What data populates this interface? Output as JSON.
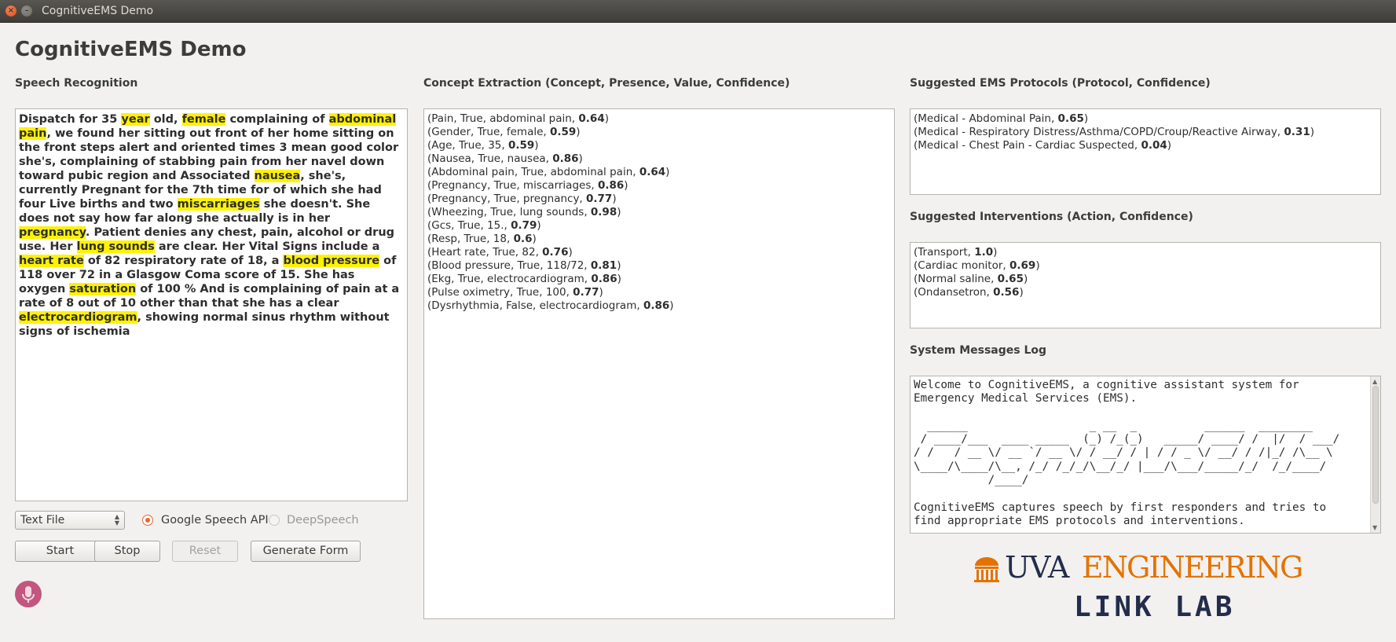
{
  "window": {
    "title": "CognitiveEMS Demo"
  },
  "app": {
    "title": "CognitiveEMS Demo"
  },
  "speech": {
    "label": "Speech Recognition",
    "segments": [
      {
        "t": "Dispatch for 35 ",
        "h": false
      },
      {
        "t": "year",
        "h": true
      },
      {
        "t": " old, ",
        "h": false
      },
      {
        "t": "female",
        "h": true
      },
      {
        "t": " complaining of ",
        "h": false
      },
      {
        "t": "abdominal pain",
        "h": true
      },
      {
        "t": ", we found her sitting out front of her home sitting on the front steps alert and oriented times 3 mean good color she's, complaining of stabbing pain from her navel down toward pubic region and Associated ",
        "h": false
      },
      {
        "t": "nausea",
        "h": true
      },
      {
        "t": ", she's, currently Pregnant for the 7th time for of which she had four Live births and two ",
        "h": false
      },
      {
        "t": "miscarriages",
        "h": true
      },
      {
        "t": " she doesn't. She does not say how far along she actually is in her ",
        "h": false
      },
      {
        "t": "pregnancy",
        "h": true
      },
      {
        "t": ". Patient denies any chest, pain, alcohol or drug use. Her ",
        "h": false
      },
      {
        "t": "lung sounds",
        "h": true
      },
      {
        "t": " are clear. Her Vital Signs include a ",
        "h": false
      },
      {
        "t": "heart rate",
        "h": true
      },
      {
        "t": " of 82 respiratory rate of 18, a ",
        "h": false
      },
      {
        "t": "blood pressure",
        "h": true
      },
      {
        "t": " of 118 over 72 in a Glasgow Coma score of 15. She has oxygen ",
        "h": false
      },
      {
        "t": "saturation",
        "h": true
      },
      {
        "t": " of 100 % And is complaining of pain at a rate of 8 out of 10 other than that she has a clear ",
        "h": false
      },
      {
        "t": "electrocardiogram",
        "h": true
      },
      {
        "t": ", showing normal sinus rhythm without signs of ischemia",
        "h": false
      }
    ]
  },
  "concepts": {
    "label": "Concept Extraction (Concept, Presence, Value, Confidence)",
    "items": [
      {
        "text": "(Pain, True, abdominal pain, ",
        "conf": "0.64"
      },
      {
        "text": "(Gender, True, female, ",
        "conf": "0.59"
      },
      {
        "text": "(Age, True, 35, ",
        "conf": "0.59"
      },
      {
        "text": "(Nausea, True, nausea, ",
        "conf": "0.86"
      },
      {
        "text": "(Abdominal pain, True, abdominal pain, ",
        "conf": "0.64"
      },
      {
        "text": "(Pregnancy, True, miscarriages, ",
        "conf": "0.86"
      },
      {
        "text": "(Pregnancy, True, pregnancy, ",
        "conf": "0.77"
      },
      {
        "text": "(Wheezing, True, lung sounds, ",
        "conf": "0.98"
      },
      {
        "text": "(Gcs, True, 15., ",
        "conf": "0.79"
      },
      {
        "text": "(Resp, True, 18, ",
        "conf": "0.6"
      },
      {
        "text": "(Heart rate, True, 82, ",
        "conf": "0.76"
      },
      {
        "text": "(Blood pressure, True, 118/72, ",
        "conf": "0.81"
      },
      {
        "text": "(Ekg, True, electrocardiogram, ",
        "conf": "0.86"
      },
      {
        "text": "(Pulse oximetry, True, 100, ",
        "conf": "0.77"
      },
      {
        "text": "(Dysrhythmia, False, electrocardiogram, ",
        "conf": "0.86"
      }
    ]
  },
  "protocols": {
    "label": "Suggested EMS Protocols (Protocol, Confidence)",
    "items": [
      {
        "text": "(Medical - Abdominal Pain, ",
        "conf": "0.65"
      },
      {
        "text": "(Medical - Respiratory Distress/Asthma/COPD/Croup/Reactive Airway, ",
        "conf": "0.31"
      },
      {
        "text": "(Medical - Chest Pain - Cardiac Suspected, ",
        "conf": "0.04"
      }
    ]
  },
  "interventions": {
    "label": "Suggested Interventions (Action, Confidence)",
    "items": [
      {
        "text": "(Transport, ",
        "conf": "1.0"
      },
      {
        "text": "(Cardiac monitor, ",
        "conf": "0.69"
      },
      {
        "text": "(Normal saline, ",
        "conf": "0.65"
      },
      {
        "text": "(Ondansetron, ",
        "conf": "0.56"
      }
    ]
  },
  "log": {
    "label": "System Messages Log",
    "lines": [
      "Welcome to CognitiveEMS, a cognitive assistant system for",
      "Emergency Medical Services (EMS).",
      "",
      "  ______                  _ __  _          ______  ________",
      " / ____/___  ____ _____  (_) /_(_)   _____/ ____/ /  |/  / ___/",
      "/ /   / __ \\/ __ `/ __ \\/ / __/ / | / / _ \\/ __/ / /|_/ /\\__ \\ ",
      "\\____/\\____/\\__, /_/ /_/_/\\__/_/ |___/\\___/_____/_/  /_/____/",
      "           /____/",
      "",
      "CognitiveEMS captures speech by first responders and tries to",
      "find appropriate EMS protocols and interventions."
    ]
  },
  "controls": {
    "source_select": "Text File",
    "radio_google": "Google Speech API",
    "radio_deepspeech": "DeepSpeech",
    "start": "Start",
    "stop": "Stop",
    "reset": "Reset",
    "generate": "Generate Form"
  },
  "logo": {
    "uva": "UVA",
    "engineering": "ENGINEERING",
    "lab": "LINK LAB"
  },
  "colors": {
    "highlight": "#fff200",
    "accent_orange": "#e57200",
    "uva_navy": "#232d4b",
    "mic": "#c2567f"
  }
}
